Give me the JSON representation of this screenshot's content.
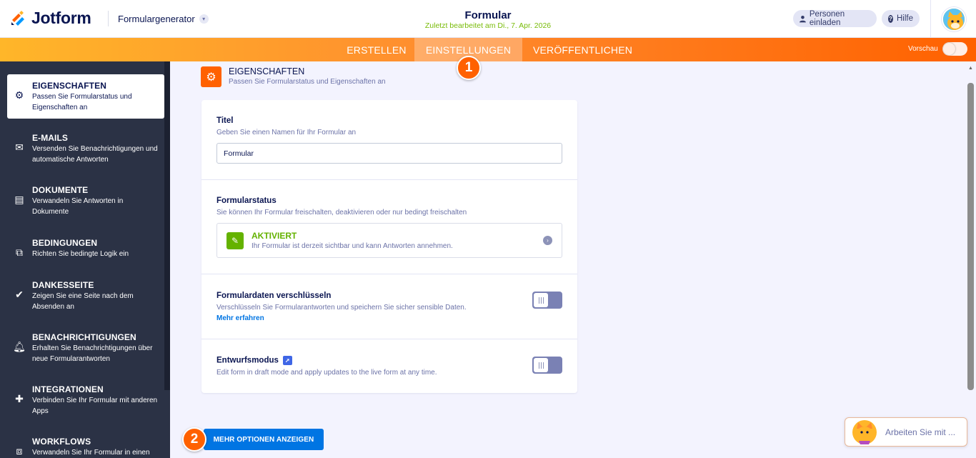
{
  "header": {
    "brand": "Jotform",
    "product_menu": "Formulargenerator",
    "form_title": "Formular",
    "last_edited": "Zuletzt bearbeitet am Di., 7. Apr. 2026",
    "invite_label": "Personen einladen",
    "help_label": "Hilfe",
    "help_icon_text": "?"
  },
  "nav": {
    "tabs": [
      {
        "label": "ERSTELLEN"
      },
      {
        "label": "EINSTELLUNGEN"
      },
      {
        "label": "VERÖFFENTLICHEN"
      }
    ],
    "active_tab": "EINSTELLUNGEN",
    "preview_label": "Vorschau",
    "preview_enabled": false
  },
  "callouts": [
    "1",
    "2"
  ],
  "sidebar": {
    "items": [
      {
        "title": "EIGENSCHAFTEN",
        "desc": "Passen Sie Formularstatus und Eigenschaften an",
        "icon": "gear-icon",
        "active": true
      },
      {
        "title": "E-MAILS",
        "desc": "Versenden Sie Benachrichtigungen und automatische Antworten",
        "icon": "envelope-icon"
      },
      {
        "title": "DOKUMENTE",
        "desc": "Verwandeln Sie Antworten in Dokumente",
        "icon": "document-icon"
      },
      {
        "title": "BEDINGUNGEN",
        "desc": "Richten Sie bedingte Logik ein",
        "icon": "sitemap-icon"
      },
      {
        "title": "DANKESSEITE",
        "desc": "Zeigen Sie eine Seite nach dem Absenden an",
        "icon": "check-circle-icon"
      },
      {
        "title": "BENACHRICHTIGUNGEN",
        "desc": "Erhalten Sie Benachrichtigungen über neue Formularantworten",
        "icon": "bell-icon"
      },
      {
        "title": "INTEGRATIONEN",
        "desc": "Verbinden Sie Ihr Formular mit anderen Apps",
        "icon": "puzzle-icon"
      },
      {
        "title": "WORKFLOWS",
        "desc": "Verwandeln Sie Ihr Formular in einen",
        "icon": "workflow-icon"
      }
    ]
  },
  "section": {
    "title": "EIGENSCHAFTEN",
    "desc": "Passen Sie Formularstatus und Eigenschaften an"
  },
  "settings": {
    "title_label": "Titel",
    "title_hint": "Geben Sie einen Namen für Ihr Formular an",
    "title_value": "Formular",
    "status_label": "Formularstatus",
    "status_hint": "Sie können Ihr Formular freischalten, deaktivieren oder nur bedingt freischalten",
    "status_value": "AKTIVIERT",
    "status_desc": "Ihr Formular ist derzeit sichtbar und kann Antworten annehmen.",
    "encrypt_label": "Formulardaten verschlüsseln",
    "encrypt_hint": "Verschlüsseln Sie Formularantworten und speichern Sie sicher sensible Daten.",
    "encrypt_link": "Mehr erfahren",
    "encrypt_enabled": false,
    "draft_label": "Entwurfsmodus",
    "draft_hint": "Edit form in draft mode and apply updates to the live form at any time.",
    "draft_enabled": false
  },
  "more_options_label": "MEHR OPTIONEN ANZEIGEN",
  "chat": {
    "label": "Arbeiten Sie mit ..."
  },
  "colors": {
    "accent": "#ff6100",
    "primary": "#0075e3",
    "sidebar": "#2b3245",
    "success": "#64b200"
  }
}
